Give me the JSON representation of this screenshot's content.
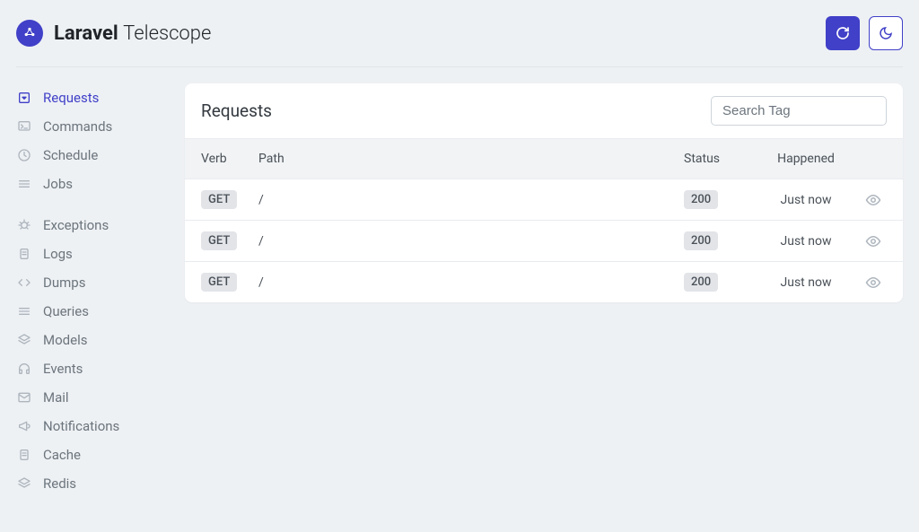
{
  "brand": {
    "bold": "Laravel",
    "light": "Telescope"
  },
  "colors": {
    "primary": "#4040c8"
  },
  "sidebar": {
    "groups": [
      [
        {
          "label": "Requests",
          "icon": "request",
          "active": true
        },
        {
          "label": "Commands",
          "icon": "terminal",
          "active": false
        },
        {
          "label": "Schedule",
          "icon": "clock",
          "active": false
        },
        {
          "label": "Jobs",
          "icon": "list",
          "active": false
        }
      ],
      [
        {
          "label": "Exceptions",
          "icon": "bug",
          "active": false
        },
        {
          "label": "Logs",
          "icon": "clipboard",
          "active": false
        },
        {
          "label": "Dumps",
          "icon": "code",
          "active": false
        },
        {
          "label": "Queries",
          "icon": "list",
          "active": false
        },
        {
          "label": "Models",
          "icon": "layers",
          "active": false
        },
        {
          "label": "Events",
          "icon": "headphones",
          "active": false
        },
        {
          "label": "Mail",
          "icon": "mail",
          "active": false
        },
        {
          "label": "Notifications",
          "icon": "bullhorn",
          "active": false
        },
        {
          "label": "Cache",
          "icon": "clipboard",
          "active": false
        },
        {
          "label": "Redis",
          "icon": "layers",
          "active": false
        }
      ]
    ]
  },
  "page": {
    "title": "Requests",
    "search_placeholder": "Search Tag",
    "columns": {
      "verb": "Verb",
      "path": "Path",
      "status": "Status",
      "happened": "Happened"
    },
    "rows": [
      {
        "verb": "GET",
        "path": "/",
        "status": "200",
        "happened": "Just now"
      },
      {
        "verb": "GET",
        "path": "/",
        "status": "200",
        "happened": "Just now"
      },
      {
        "verb": "GET",
        "path": "/",
        "status": "200",
        "happened": "Just now"
      }
    ]
  }
}
